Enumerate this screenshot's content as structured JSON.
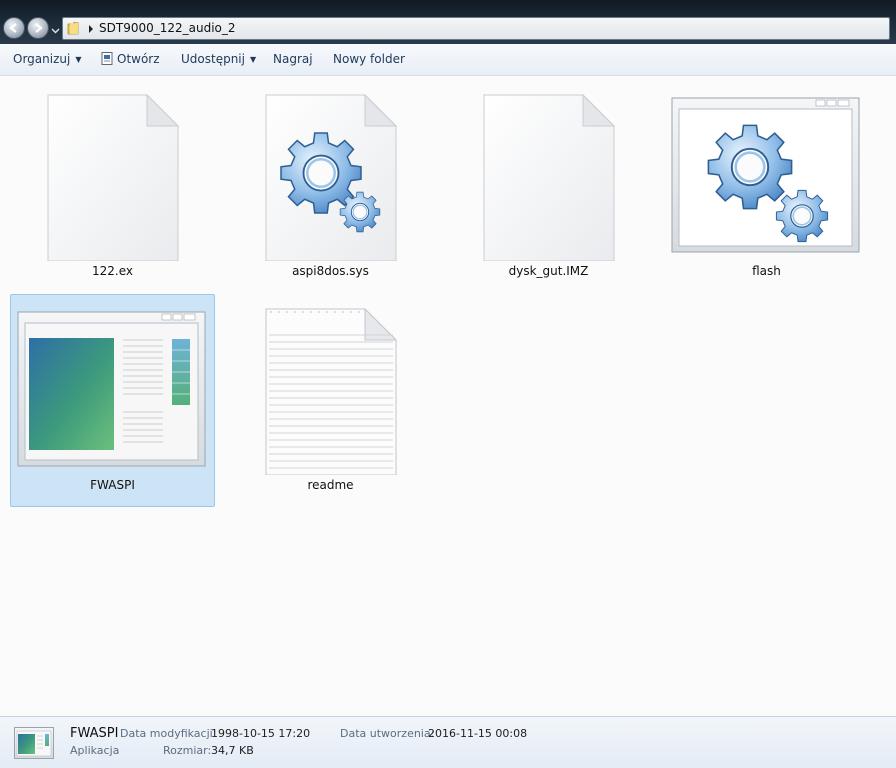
{
  "window": {
    "address_path": "SDT9000_122_audio_2"
  },
  "toolbar": {
    "organize": "Organizuj",
    "open": "Otwórz",
    "share": "Udostępnij",
    "burn": "Nagraj",
    "new_folder": "Nowy folder"
  },
  "files": [
    {
      "name": "122.ex",
      "icon": "blank-file-icon",
      "selected": false
    },
    {
      "name": "aspi8dos.sys",
      "icon": "system-file-gears-icon",
      "selected": false
    },
    {
      "name": "dysk_gut.IMZ",
      "icon": "blank-file-icon",
      "selected": false
    },
    {
      "name": "flash",
      "icon": "application-gears-icon",
      "selected": false
    },
    {
      "name": "FWASPI",
      "icon": "application-window-icon",
      "selected": true
    },
    {
      "name": "readme",
      "icon": "text-document-icon",
      "selected": false
    }
  ],
  "details": {
    "name": "FWASPI",
    "type": "Aplikacja",
    "modified_label": "Data modyfikacji:",
    "modified_value": "1998-10-15 17:20",
    "created_label": "Data utworzenia:",
    "created_value": "2016-11-15 00:08",
    "size_label": "Rozmiar:",
    "size_value": "34,7 KB"
  },
  "colors": {
    "selection_bg": "#cde4f7",
    "selection_border": "#99c8ec",
    "toolbar_text": "#1e395b",
    "gear_blue": "#5b9ad8"
  }
}
